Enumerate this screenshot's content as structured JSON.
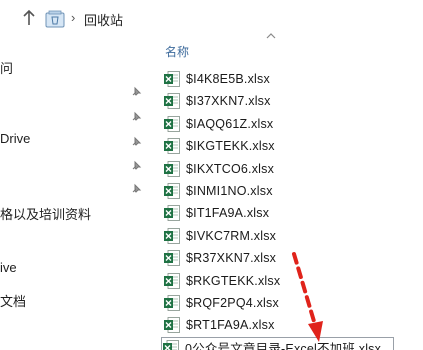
{
  "address_bar": {
    "separator": "›",
    "location": "回收站"
  },
  "nav": {
    "items": [
      {
        "label": "问"
      },
      {
        "label": "Drive"
      },
      {
        "label": "格以及培训资料"
      },
      {
        "label": "ive"
      },
      {
        "label": "文档"
      }
    ]
  },
  "file_list": {
    "column_header": "名称",
    "files": [
      {
        "name": "$I4K8E5B.xlsx"
      },
      {
        "name": "$I37XKN7.xlsx"
      },
      {
        "name": "$IAQQ61Z.xlsx"
      },
      {
        "name": "$IKGTEKK.xlsx"
      },
      {
        "name": "$IKXTCO6.xlsx"
      },
      {
        "name": "$INMI1NO.xlsx"
      },
      {
        "name": "$IT1FA9A.xlsx"
      },
      {
        "name": "$IVKC7RM.xlsx"
      },
      {
        "name": "$R37XKN7.xlsx"
      },
      {
        "name": "$RKGTEKK.xlsx"
      },
      {
        "name": "$RQF2PQ4.xlsx"
      },
      {
        "name": "$RT1FA9A.xlsx"
      },
      {
        "name": "0公众号文章目录-Excel不加班.xlsx"
      }
    ]
  },
  "colors": {
    "excel_green": "#1f7244",
    "arrow_red": "#e0231b",
    "header_blue": "#3e6b9c"
  }
}
